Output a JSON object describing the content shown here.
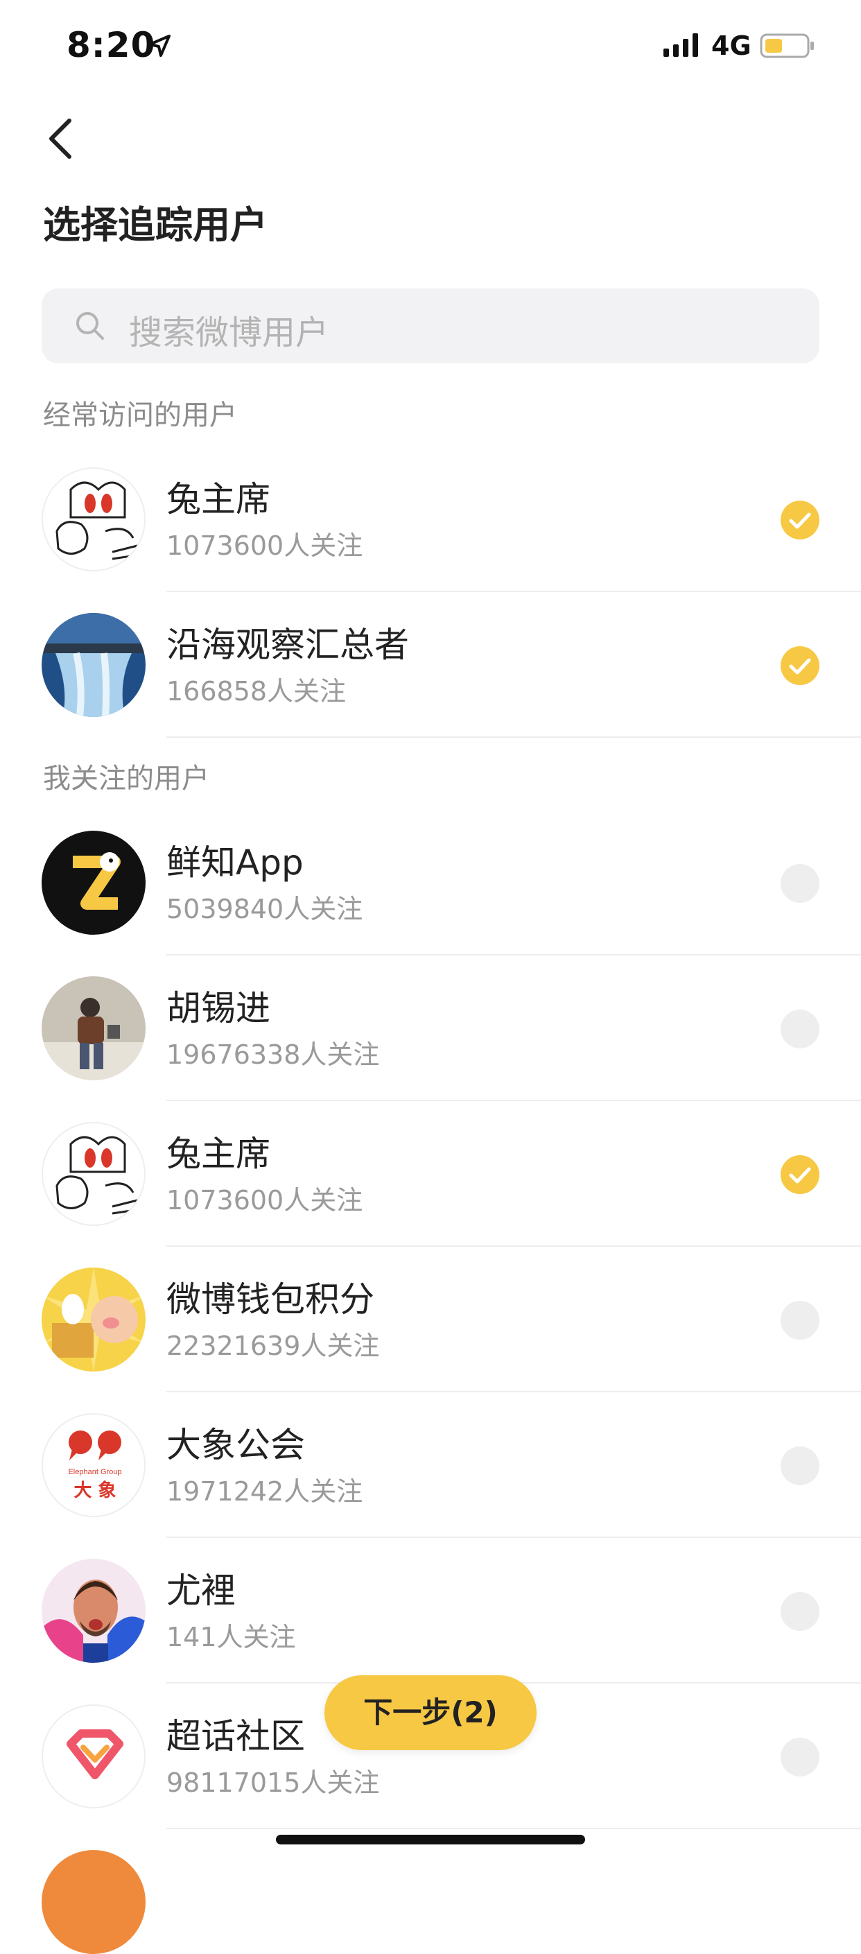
{
  "status_bar": {
    "time": "8:20",
    "network": "4G"
  },
  "header": {
    "back_icon": "chevron-left-icon",
    "title": "选择追踪用户"
  },
  "search": {
    "placeholder": "搜索微博用户",
    "icon": "search-icon"
  },
  "sections": {
    "frequent": "经常访问的用户",
    "following": "我关注的用户"
  },
  "frequent_users": [
    {
      "name": "兔主席",
      "fans": "1073600人关注",
      "selected": true
    },
    {
      "name": "沿海观察汇总者",
      "fans": "166858人关注",
      "selected": true
    }
  ],
  "following_users": [
    {
      "name": "鲜知App",
      "fans": "5039840人关注",
      "selected": false
    },
    {
      "name": "胡锡进",
      "fans": "19676338人关注",
      "selected": false
    },
    {
      "name": "兔主席",
      "fans": "1073600人关注",
      "selected": true
    },
    {
      "name": "微博钱包积分",
      "fans": "22321639人关注",
      "selected": false
    },
    {
      "name": "大象公会",
      "fans": "1971242人关注",
      "selected": false,
      "logo_text": "Elephant Group",
      "logo_cn": "大 象"
    },
    {
      "name": "尤裡",
      "fans": "141人关注",
      "selected": false
    },
    {
      "name": "超话社区",
      "fans": "98117015人关注",
      "selected": false
    }
  ],
  "next_button": {
    "label": "下一步(2)"
  },
  "colors": {
    "accent": "#f7c844",
    "unselected": "#eeeeee",
    "secondary_text": "#9a9a9a"
  }
}
